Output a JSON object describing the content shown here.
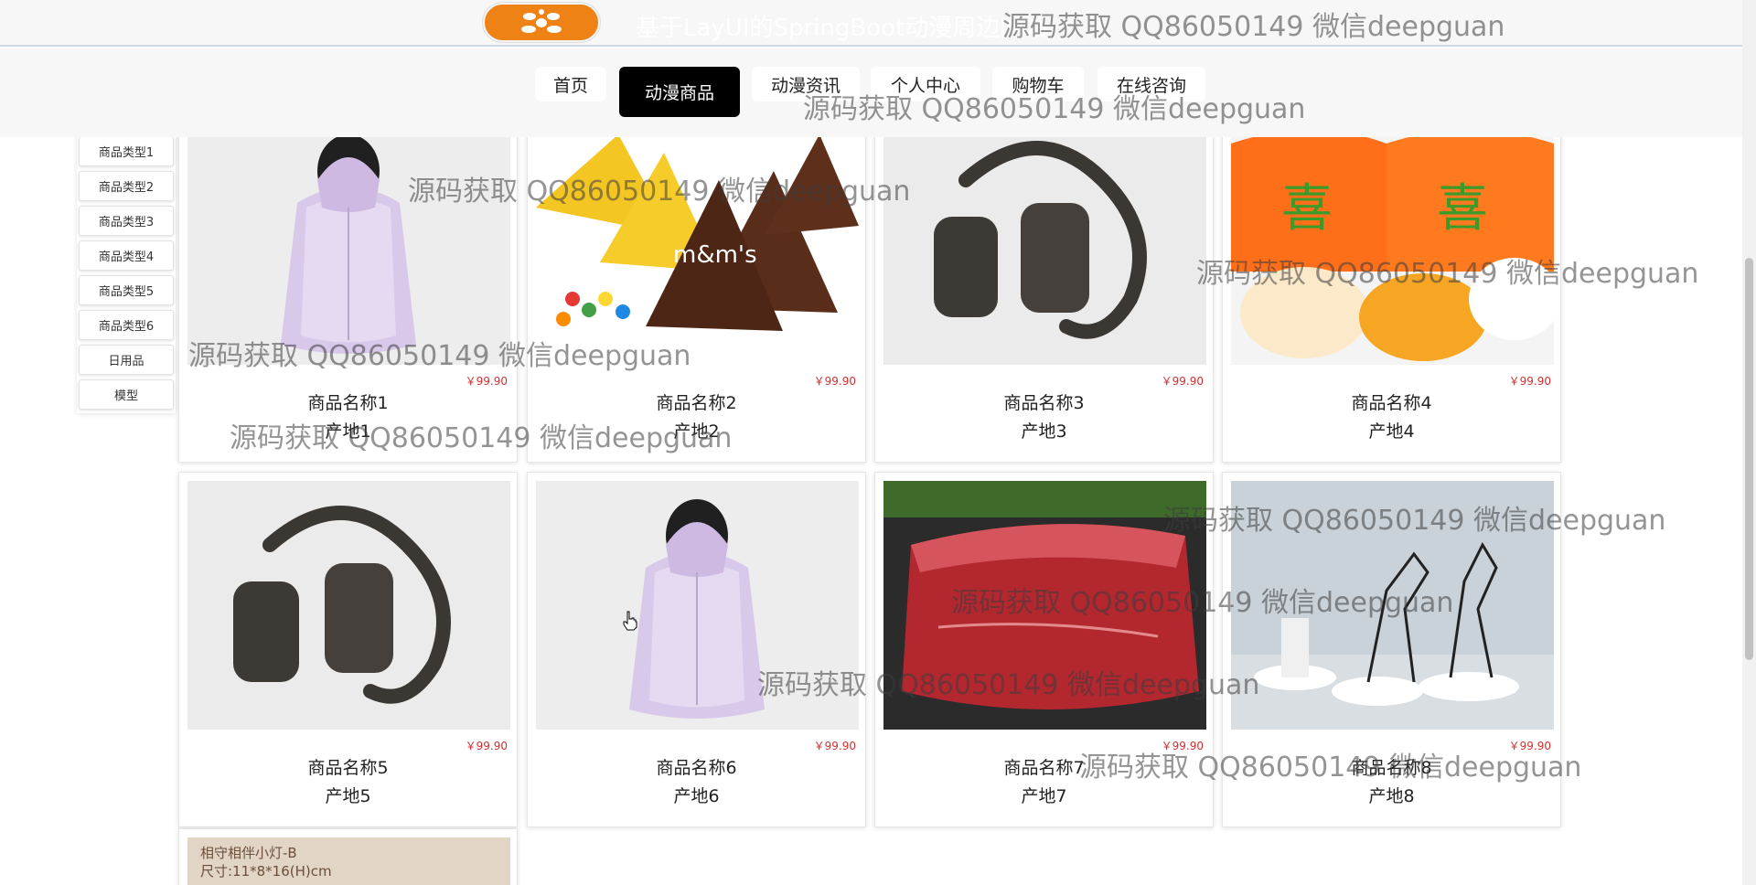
{
  "header": {
    "site_title": "基于LayUI的SpringBoot动漫周边网站",
    "logo_icon": "flower-logo-icon"
  },
  "nav": {
    "items": [
      {
        "label": "首页"
      },
      {
        "label": "动漫商品",
        "active": true
      },
      {
        "label": "动漫资讯"
      },
      {
        "label": "个人中心"
      },
      {
        "label": "购物车"
      },
      {
        "label": "在线咨询"
      }
    ]
  },
  "sidebar": {
    "categories": [
      "商品类型1",
      "商品类型2",
      "商品类型3",
      "商品类型4",
      "商品类型5",
      "商品类型6",
      "日用品",
      "模型"
    ]
  },
  "products": [
    {
      "name": "商品名称1",
      "origin": "产地1",
      "price": "￥99.90",
      "image": "pink-puffer-vest"
    },
    {
      "name": "商品名称2",
      "origin": "产地2",
      "price": "￥99.90",
      "image": "mm-chocolate-packs"
    },
    {
      "name": "商品名称3",
      "origin": "产地3",
      "price": "￥99.90",
      "image": "fur-gloves"
    },
    {
      "name": "商品名称4",
      "origin": "产地4",
      "price": "￥99.90",
      "image": "jelly-candy-pack"
    },
    {
      "name": "商品名称5",
      "origin": "产地5",
      "price": "￥99.90",
      "image": "fur-gloves"
    },
    {
      "name": "商品名称6",
      "origin": "产地6",
      "price": "￥99.90",
      "image": "pink-puffer-vest"
    },
    {
      "name": "商品名称7",
      "origin": "产地7",
      "price": "￥99.90",
      "image": "raw-beef-block"
    },
    {
      "name": "商品名称8",
      "origin": "产地8",
      "price": "￥99.90",
      "image": "wire-deer-sculptures"
    },
    {
      "name": "",
      "origin": "",
      "price": "",
      "image": "lamp-box",
      "image_text_1": "相守相伴小灯-B",
      "image_text_2": "尺寸:11*8*16(H)cm"
    }
  ],
  "watermark": {
    "text": "源码获取 QQ86050149 微信deepguan"
  },
  "colors": {
    "nav_active_bg": "#000000",
    "price": "#d32f2f",
    "logo_bg": "#ee8214",
    "header_bg": "#f7f7f7"
  }
}
